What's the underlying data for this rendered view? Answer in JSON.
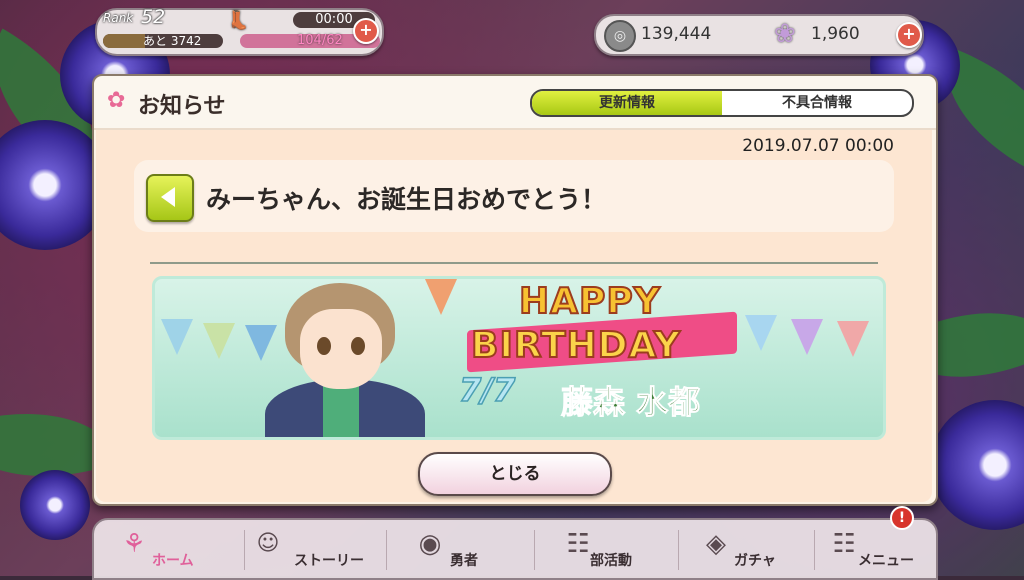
{
  "hud": {
    "rank_label": "Rank",
    "rank_value": "52",
    "exp_text": "あと 3742",
    "timer": "00:00",
    "stamina_text": "104/62",
    "coins": "139,444",
    "gems": "1,960",
    "plus_symbol": "+"
  },
  "modal": {
    "title": "お知らせ",
    "tabs": [
      {
        "label": "更新情報",
        "active": true
      },
      {
        "label": "不具合情報",
        "active": false
      }
    ],
    "date": "2019.07.07 00:00",
    "news_title": "みーちゃん、お誕生日おめでとう！",
    "banner": {
      "line1": "HAPPY",
      "line2": "BIRTHDAY",
      "date": "7/7",
      "name": "藤森 水都"
    },
    "close_label": "とじる"
  },
  "nav": {
    "items": [
      {
        "label": "ホーム",
        "icon": "home-icon",
        "active": true
      },
      {
        "label": "ストーリー",
        "icon": "story-icon",
        "active": false
      },
      {
        "label": "勇者",
        "icon": "hero-icon",
        "active": false
      },
      {
        "label": "部活動",
        "icon": "club-icon",
        "active": false
      },
      {
        "label": "ガチャ",
        "icon": "gacha-icon",
        "active": false
      },
      {
        "label": "メニュー",
        "icon": "menu-grid-icon",
        "active": false
      }
    ],
    "alert": "!"
  },
  "colors": {
    "accent_green": "#a8c814",
    "accent_pink": "#e0609a",
    "modal_bg": "#fde6d2"
  }
}
